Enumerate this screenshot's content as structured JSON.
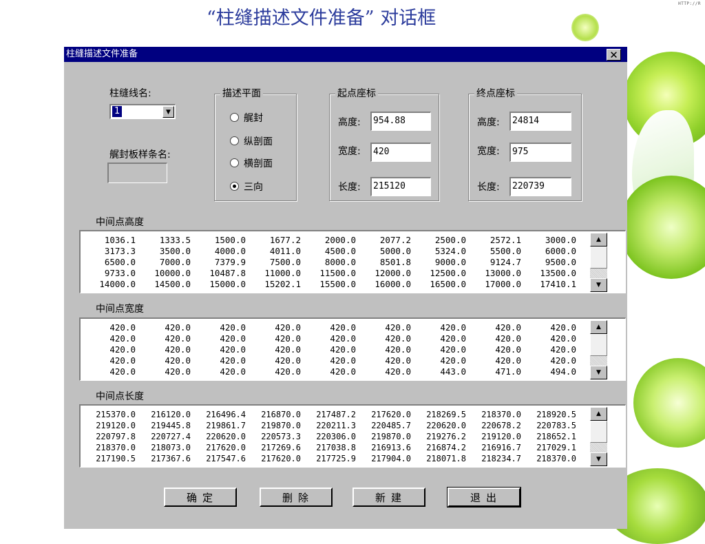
{
  "slide": {
    "title": "“柱缝描述文件准备” 对话框",
    "corner_tag": "HTTP://R"
  },
  "dialog": {
    "title": "柱缝描述文件准备",
    "close_glyph": "✕",
    "seam_line_label": "柱缝线名:",
    "seam_line_value": "1",
    "board_strip_label": "艉封板样条名:",
    "board_strip_value": "",
    "plane_group": {
      "title": "描述平面",
      "options": [
        "艉封",
        "纵剖面",
        "横剖面",
        "三向"
      ],
      "selected": "三向"
    },
    "start_group": {
      "title": "起点座标",
      "height_label": "高度:",
      "height_value": "954.88",
      "width_label": "宽度:",
      "width_value": "420",
      "length_label": "长度:",
      "length_value": "215120"
    },
    "end_group": {
      "title": "终点座标",
      "height_label": "高度:",
      "height_value": "24814",
      "width_label": "宽度:",
      "width_value": "975",
      "length_label": "长度:",
      "length_value": "220739"
    },
    "mid_height": {
      "label": "中间点高度",
      "rows": [
        [
          "1036.1",
          "1333.5",
          "1500.0",
          "1677.2",
          "2000.0",
          "2077.2",
          "2500.0",
          "2572.1",
          "3000.0"
        ],
        [
          "3173.3",
          "3500.0",
          "4000.0",
          "4011.0",
          "4500.0",
          "5000.0",
          "5324.0",
          "5500.0",
          "6000.0"
        ],
        [
          "6500.0",
          "7000.0",
          "7379.9",
          "7500.0",
          "8000.0",
          "8501.8",
          "9000.0",
          "9124.7",
          "9500.0"
        ],
        [
          "9733.0",
          "10000.0",
          "10487.8",
          "11000.0",
          "11500.0",
          "12000.0",
          "12500.0",
          "13000.0",
          "13500.0"
        ],
        [
          "14000.0",
          "14500.0",
          "15000.0",
          "15202.1",
          "15500.0",
          "16000.0",
          "16500.0",
          "17000.0",
          "17410.1"
        ]
      ]
    },
    "mid_width": {
      "label": "中间点宽度",
      "rows": [
        [
          "420.0",
          "420.0",
          "420.0",
          "420.0",
          "420.0",
          "420.0",
          "420.0",
          "420.0",
          "420.0"
        ],
        [
          "420.0",
          "420.0",
          "420.0",
          "420.0",
          "420.0",
          "420.0",
          "420.0",
          "420.0",
          "420.0"
        ],
        [
          "420.0",
          "420.0",
          "420.0",
          "420.0",
          "420.0",
          "420.0",
          "420.0",
          "420.0",
          "420.0"
        ],
        [
          "420.0",
          "420.0",
          "420.0",
          "420.0",
          "420.0",
          "420.0",
          "420.0",
          "420.0",
          "420.0"
        ],
        [
          "420.0",
          "420.0",
          "420.0",
          "420.0",
          "420.0",
          "420.0",
          "443.0",
          "471.0",
          "494.0"
        ]
      ]
    },
    "mid_length": {
      "label": "中间点长度",
      "rows": [
        [
          "215370.0",
          "216120.0",
          "216496.4",
          "216870.0",
          "217487.2",
          "217620.0",
          "218269.5",
          "218370.0",
          "218920.5"
        ],
        [
          "219120.0",
          "219445.8",
          "219861.7",
          "219870.0",
          "220211.3",
          "220485.7",
          "220620.0",
          "220678.2",
          "220783.5"
        ],
        [
          "220797.8",
          "220727.4",
          "220620.0",
          "220573.3",
          "220306.0",
          "219870.0",
          "219276.2",
          "219120.0",
          "218652.1"
        ],
        [
          "218370.0",
          "218073.0",
          "217620.0",
          "217269.6",
          "217038.8",
          "216913.6",
          "216874.2",
          "216916.7",
          "217029.1"
        ],
        [
          "217190.5",
          "217367.6",
          "217547.6",
          "217620.0",
          "217725.9",
          "217904.0",
          "218071.8",
          "218234.7",
          "218370.0"
        ]
      ]
    },
    "buttons": {
      "ok": "确定",
      "delete": "删除",
      "new": "新建",
      "exit": "退出"
    }
  }
}
